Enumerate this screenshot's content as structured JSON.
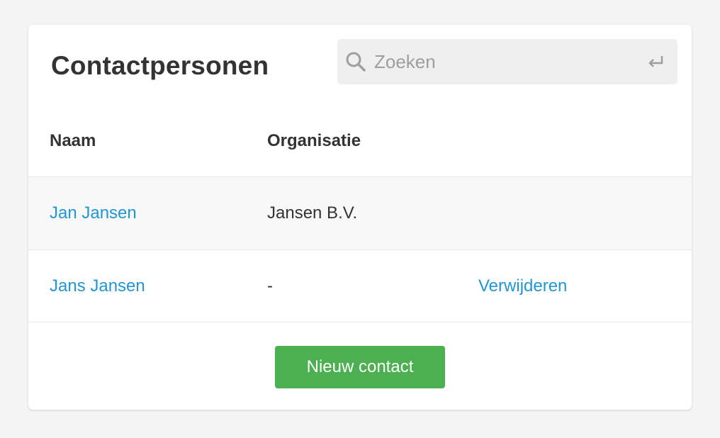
{
  "card": {
    "title": "Contactpersonen"
  },
  "search": {
    "placeholder": "Zoeken",
    "value": "",
    "icon": "search-icon",
    "submit_icon": "enter-icon"
  },
  "table": {
    "columns": [
      "Naam",
      "Organisatie",
      ""
    ],
    "rows": [
      {
        "name": "Jan Jansen",
        "organization": "Jansen B.V.",
        "action": ""
      },
      {
        "name": "Jans Jansen",
        "organization": "-",
        "action": "Verwijderen"
      }
    ]
  },
  "footer": {
    "new_button_label": "Nieuw contact"
  },
  "colors": {
    "link": "#1f97d4",
    "primary_button": "#4caf50",
    "page_background": "#f4f4f4"
  }
}
